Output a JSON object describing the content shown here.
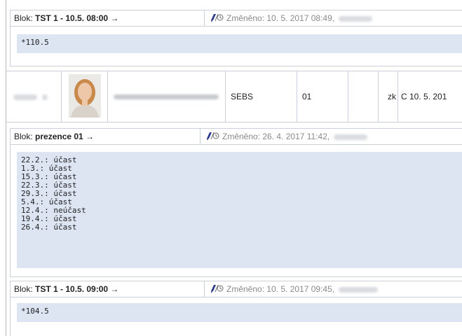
{
  "blocks": [
    {
      "prefix": "Blok: ",
      "name": "TST 1 - 10.5. 08:00 →",
      "changed": "Změněno: 10. 5. 2017 08:49,",
      "content": "*110.5"
    },
    {
      "prefix": "Blok: ",
      "name": "prezence 01 →",
      "changed": "Změněno: 26. 4. 2017 11:42,",
      "content": "22.2.: účast\n1.3.: účast\n15.3.: účast\n22.3.: účast\n29.3.: účast\n5.4.: účast\n12.4.: neúčast\n19.4.: účast\n26.4.: účast"
    },
    {
      "prefix": "Blok: ",
      "name": "TST 1 - 10.5. 09:00 →",
      "changed": "Změněno: 10. 5. 2017 09:45,",
      "content": "*104.5"
    }
  ],
  "student_row": {
    "program": "SEBS",
    "group": "01",
    "completion": "zk",
    "result": "C 10. 5. 201"
  },
  "icons": {
    "note": "note-history-icon",
    "photo": "student-photo"
  },
  "colors": {
    "content_bg": "#dde5f3",
    "border": "#c9d1dc",
    "muted_text": "#8a8a8a",
    "blurred": "#d9dce0"
  }
}
